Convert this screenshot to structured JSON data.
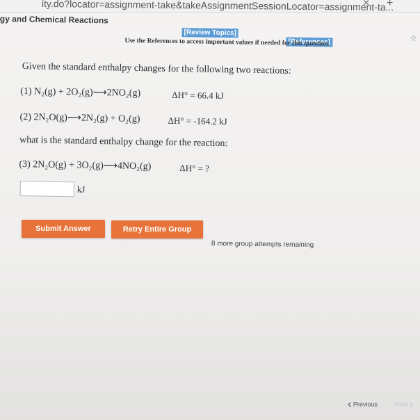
{
  "browser": {
    "url_text": "ity.do?locator=assignment-take&takeAssignmentSessionLocator=assignment-ta...",
    "close_glyph": "×",
    "new_tab_glyph": "+",
    "star_glyph": "☆"
  },
  "header": {
    "section_title": "gy and Chemical Reactions",
    "review_topics": "[Review Topics]",
    "references": "[References]",
    "references_note": "Use the References to access important values if needed for this question."
  },
  "question": {
    "intro": "Given the standard enthalpy changes for the following two reactions:",
    "reaction1": "(1) N₂(g) + 2O₂(g)⟶2NO₂(g)",
    "dh1": "ΔH° = 66.4 kJ",
    "reaction2": "(2) 2N₂O(g)⟶2N₂(g) + O₂(g)",
    "dh2": "ΔH° = -164.2 kJ",
    "prompt": "what is the standard enthalpy change for the reaction:",
    "reaction3": "(3) 2N₂O(g) + 3O₂(g)⟶4NO₂(g)",
    "dh3": "ΔH° = ?",
    "answer_value": "",
    "unit": "kJ"
  },
  "actions": {
    "submit": "Submit Answer",
    "retry": "Retry Entire Group",
    "attempts": "8 more group attempts remaining"
  },
  "pager": {
    "previous": "Previous",
    "next": "Next"
  },
  "colors": {
    "button": "#e8733a",
    "link_bg": "#5a9bd5"
  }
}
